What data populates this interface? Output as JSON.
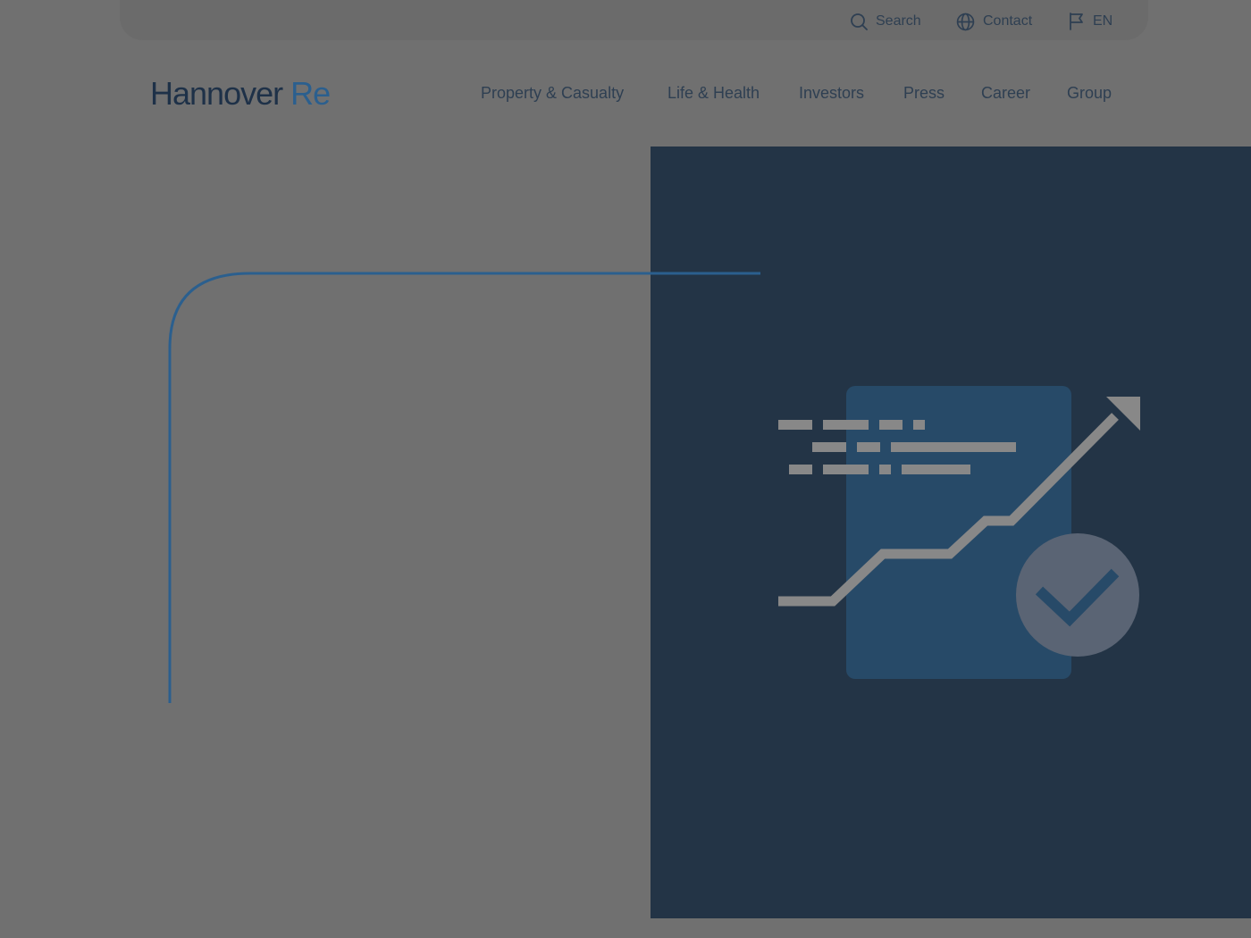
{
  "utility": {
    "search_label": "Search",
    "contact_label": "Contact",
    "language_label": "EN"
  },
  "logo": {
    "name_part": "Hannover",
    "re_part": "Re"
  },
  "nav": {
    "items": [
      {
        "label": "Property & Casualty"
      },
      {
        "label": "Life & Health"
      },
      {
        "label": "Investors"
      },
      {
        "label": "Press"
      },
      {
        "label": "Career"
      },
      {
        "label": "Group"
      }
    ]
  },
  "icons": {
    "search": "search-icon",
    "contact": "globe-icon",
    "language": "flag-icon",
    "illustration": "growth-document-check-illustration"
  },
  "colors": {
    "overlay": "#707070",
    "navy": "#233446",
    "brand_blue": "#2b5f8e",
    "text": "#2e3f52"
  }
}
